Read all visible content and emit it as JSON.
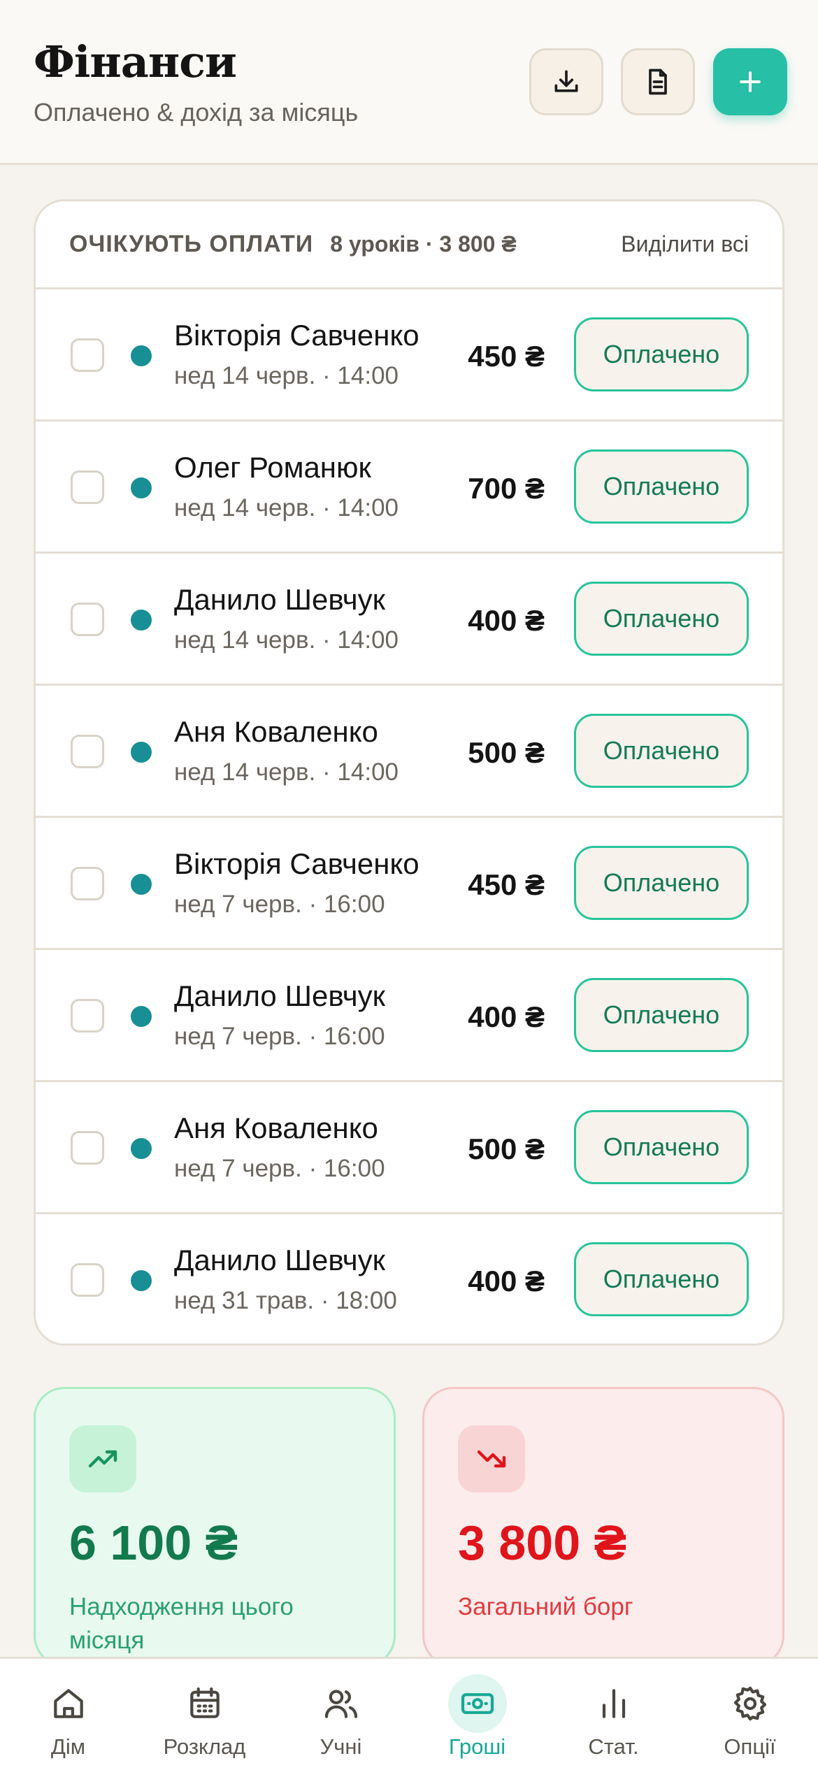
{
  "header": {
    "title": "Фінанси",
    "subtitle": "Оплачено & дохід за місяць",
    "buttons": {
      "download_icon": "download-icon",
      "report_icon": "document-icon",
      "add_icon": "plus-icon"
    }
  },
  "pending": {
    "title": "ОЧІКУЮТЬ ОПЛАТИ",
    "meta": "8 уроків · 3 800 ₴",
    "select_all": "Виділити всі",
    "paid_label": "Оплачено",
    "rows": [
      {
        "name": "Вікторія Савченко",
        "date": "нед 14 черв. · 14:00",
        "amount": "450 ₴"
      },
      {
        "name": "Олег Романюк",
        "date": "нед 14 черв. · 14:00",
        "amount": "700 ₴"
      },
      {
        "name": "Данило Шевчук",
        "date": "нед 14 черв. · 14:00",
        "amount": "400 ₴"
      },
      {
        "name": "Аня Коваленко",
        "date": "нед 14 черв. · 14:00",
        "amount": "500 ₴"
      },
      {
        "name": "Вікторія Савченко",
        "date": "нед 7 черв. · 16:00",
        "amount": "450 ₴"
      },
      {
        "name": "Данило Шевчук",
        "date": "нед 7 черв. · 16:00",
        "amount": "400 ₴"
      },
      {
        "name": "Аня Коваленко",
        "date": "нед 7 черв. · 16:00",
        "amount": "500 ₴"
      },
      {
        "name": "Данило Шевчук",
        "date": "нед 31 трав. · 18:00",
        "amount": "400 ₴"
      }
    ]
  },
  "stats": {
    "income": {
      "value": "6 100 ₴",
      "label": "Надходження цього місяця",
      "icon": "trending-up-icon",
      "color": "#127a4d"
    },
    "debt": {
      "value": "3 800 ₴",
      "label": "Загальний борг",
      "icon": "trending-down-icon",
      "color": "#e0141b"
    }
  },
  "nav": {
    "items": [
      {
        "label": "Дім",
        "icon": "home-icon"
      },
      {
        "label": "Розклад",
        "icon": "calendar-icon"
      },
      {
        "label": "Учні",
        "icon": "users-icon"
      },
      {
        "label": "Гроші",
        "icon": "money-icon",
        "active": true
      },
      {
        "label": "Стат.",
        "icon": "bar-chart-icon"
      },
      {
        "label": "Опції",
        "icon": "gear-icon"
      }
    ]
  },
  "colors": {
    "accent": "#27bfa6",
    "status_dot": "#178f94",
    "paid_border": "#27c49a"
  }
}
